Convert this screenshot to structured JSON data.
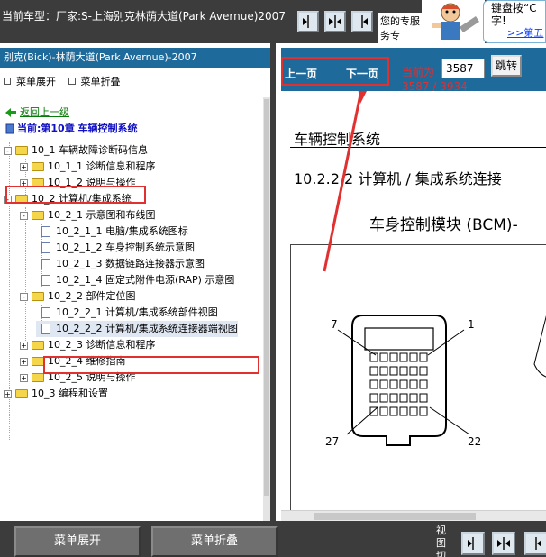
{
  "header": {
    "car_type": "当前车型：厂家:S-上海别克林荫大道(Park Avernue)2007",
    "view_buttons": [
      "view-left-icon",
      "view-split-icon",
      "view-right-icon"
    ],
    "bubble_left": "您的专服务专",
    "bubble_right_line1": "键盘按“C",
    "bubble_right_line2": "字!",
    "bubble_right_link": ">>第五"
  },
  "left_panel": {
    "title": "别克(Bick)-林荫大道(Park Avernue)-2007",
    "expand_all": "菜单展开",
    "collapse_all": "菜单折叠",
    "back_link": "返回上一级",
    "current_chapter": "当前:第10章 车辆控制系统",
    "tree": [
      {
        "label": "10_1 车辆故障诊断码信息",
        "expander": "-",
        "type": "folder"
      },
      {
        "label": "10_1_1 诊断信息和程序",
        "expander": "+",
        "type": "folder"
      },
      {
        "label": "10_1_2 说明与操作",
        "expander": "+",
        "type": "folder"
      },
      {
        "label": "10_2 计算机/集成系统",
        "expander": "-",
        "type": "folder"
      },
      {
        "label": "10_2_1 示意图和布线图",
        "expander": "-",
        "type": "folder"
      },
      {
        "label": "10_2_1_1 电脑/集成系统图标",
        "expander": "",
        "type": "doc"
      },
      {
        "label": "10_2_1_2 车身控制系统示意图",
        "expander": "",
        "type": "doc"
      },
      {
        "label": "10_2_1_3 数据链路连接器示意图",
        "expander": "",
        "type": "doc"
      },
      {
        "label": "10_2_1_4 固定式附件电源(RAP) 示意图",
        "expander": "",
        "type": "doc"
      },
      {
        "label": "10_2_2 部件定位图",
        "expander": "-",
        "type": "folder"
      },
      {
        "label": "10_2_2_1 计算机/集成系统部件视图",
        "expander": "",
        "type": "doc"
      },
      {
        "label": "10_2_2_2 计算机/集成系统连接器端视图",
        "expander": "",
        "type": "doc"
      },
      {
        "label": "10_2_3 诊断信息和程序",
        "expander": "+",
        "type": "folder"
      },
      {
        "label": "10_2_4 维修指南",
        "expander": "+",
        "type": "folder"
      },
      {
        "label": "10_2_5 说明与操作",
        "expander": "+",
        "type": "folder"
      },
      {
        "label": "10_3 编程和设置",
        "expander": "+",
        "type": "folder"
      }
    ]
  },
  "nav": {
    "prev": "上一页",
    "next": "下一页",
    "current_label": "当前为",
    "page_value": "3587",
    "jump": "跳转",
    "page_count": "3587 / 3934"
  },
  "document": {
    "h1": "车辆控制系统",
    "h2": "10.2.2.2 计算机 / 集成系统连接",
    "h3": "车身控制模块 (BCM)-",
    "pin_labels": [
      "7",
      "1",
      "27",
      "22"
    ]
  },
  "bottom": {
    "expand_all": "菜单展开",
    "collapse_all": "菜单折叠",
    "view_switch": "视图切"
  },
  "colors": {
    "header_bg": "#3c3c3c",
    "panel_blue": "#1e6a9b",
    "highlight_red": "#e03030",
    "link_green": "#0a7a0a"
  }
}
